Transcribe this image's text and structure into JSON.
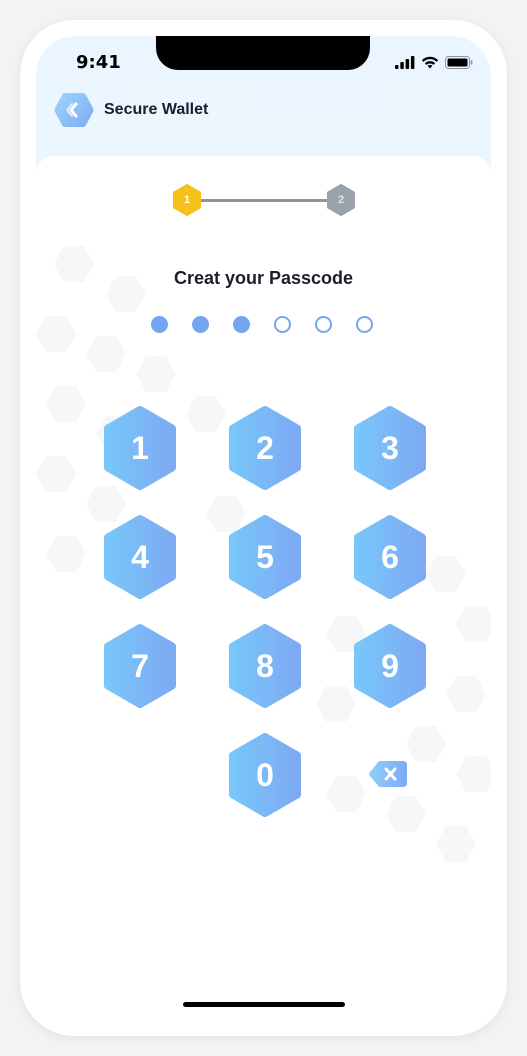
{
  "status_bar": {
    "time": "9:41",
    "icons": [
      "signal-icon",
      "wifi-icon",
      "battery-icon"
    ]
  },
  "header": {
    "title": "Secure Wallet",
    "back_icon": "chevron-left-icon"
  },
  "stepper": {
    "steps": [
      {
        "label": "1",
        "state": "active",
        "color": "#f5c21b"
      },
      {
        "label": "2",
        "state": "inactive",
        "color": "#9aa1ab"
      }
    ]
  },
  "passcode": {
    "title": "Creat your Passcode",
    "length": 6,
    "entered": 3
  },
  "keypad": {
    "keys": [
      "1",
      "2",
      "3",
      "4",
      "5",
      "6",
      "7",
      "8",
      "9",
      "0"
    ],
    "delete_icon": "backspace-icon"
  },
  "colors": {
    "accent": "#74a6f0",
    "key_gradient_start": "#78c6fa",
    "key_gradient_end": "#7eaaf3",
    "step_active": "#f5c21b",
    "step_inactive": "#9aa1ab"
  }
}
